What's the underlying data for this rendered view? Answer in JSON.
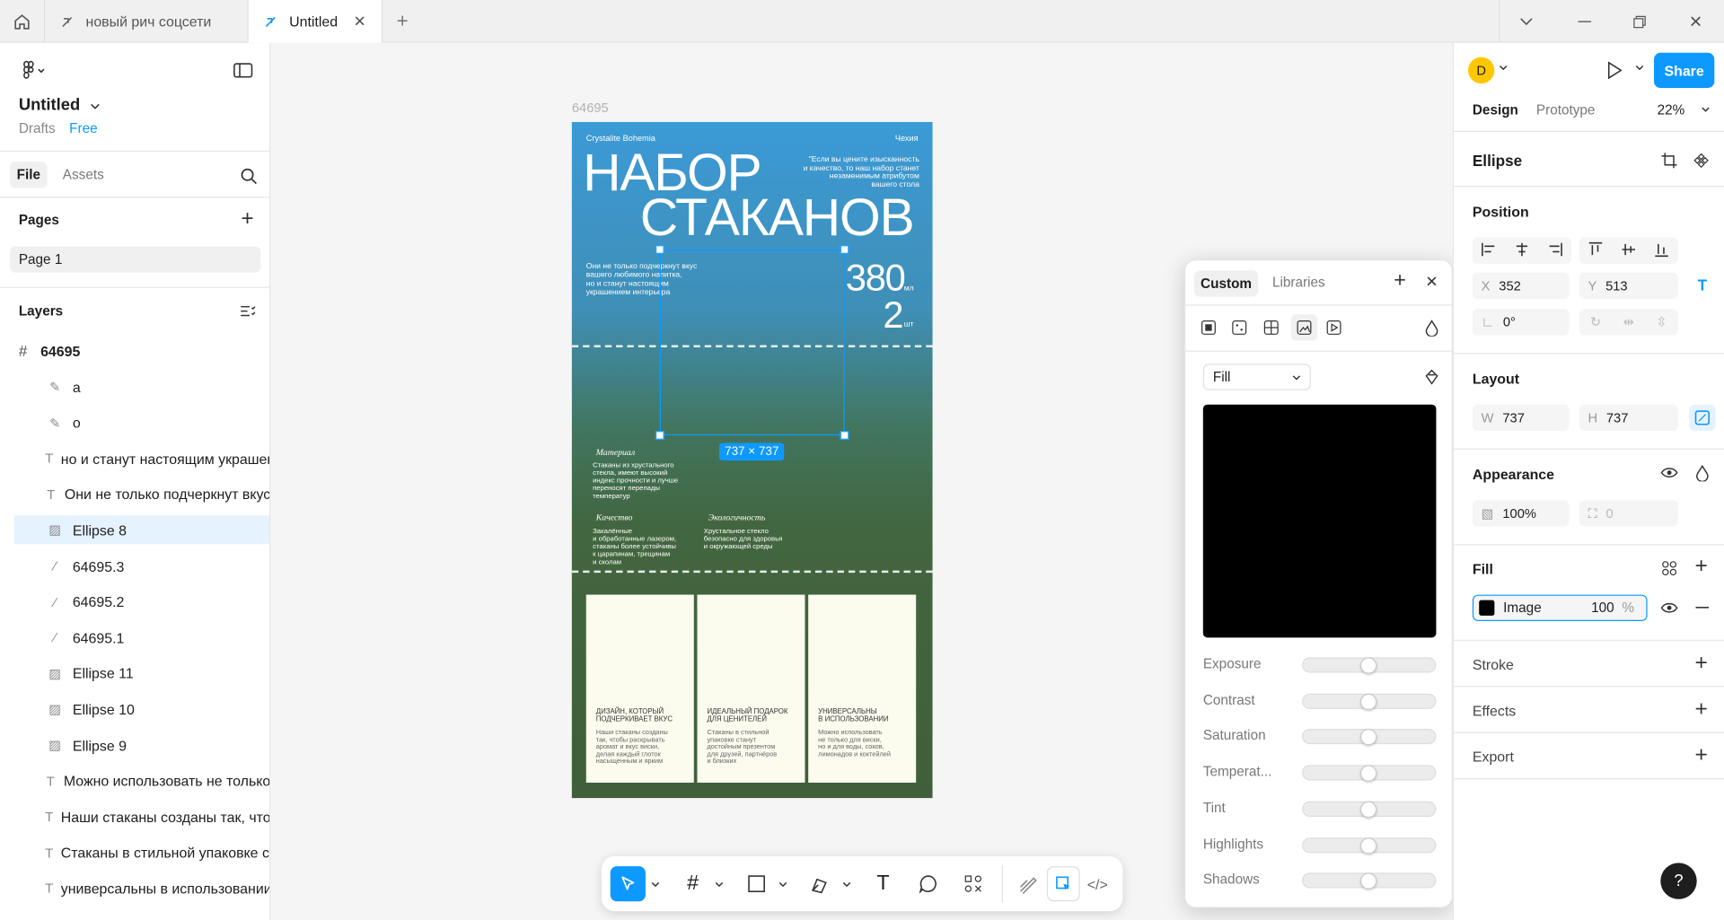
{
  "tabs": [
    {
      "label": "новый рич соцсети"
    },
    {
      "label": "Untitled"
    }
  ],
  "file": {
    "name": "Untitled",
    "drafts": "Drafts",
    "plan": "Free"
  },
  "left_tabs": {
    "file": "File",
    "assets": "Assets"
  },
  "pages": {
    "heading": "Pages",
    "items": [
      "Page 1"
    ]
  },
  "layers": {
    "heading": "Layers",
    "frame": "64695",
    "items": [
      {
        "icon": "pen-icon",
        "label": "a"
      },
      {
        "icon": "pen-icon",
        "label": "o"
      },
      {
        "icon": "text-icon",
        "label": "но и станут настоящим украшен"
      },
      {
        "icon": "text-icon",
        "label": "Они не только подчеркнут вкус"
      },
      {
        "icon": "image-icon",
        "label": "Ellipse 8",
        "selected": true
      },
      {
        "icon": "vector-icon",
        "label": "64695.3"
      },
      {
        "icon": "vector-icon",
        "label": "64695.2"
      },
      {
        "icon": "vector-icon",
        "label": "64695.1"
      },
      {
        "icon": "image-icon",
        "label": "Ellipse 11"
      },
      {
        "icon": "image-icon",
        "label": "Ellipse 10"
      },
      {
        "icon": "image-icon",
        "label": "Ellipse 9"
      },
      {
        "icon": "text-icon",
        "label": "Можно использовать не только"
      },
      {
        "icon": "text-icon",
        "label": "Наши стаканы созданы так, чтоб"
      },
      {
        "icon": "text-icon",
        "label": "Стаканы в стильной упаковке ст"
      },
      {
        "icon": "text-icon",
        "label": "универсальны в использовании"
      }
    ]
  },
  "canvas": {
    "frame_label": "64695",
    "selection_size": "737 × 737",
    "design": {
      "brand": "Crystalite Bohemia",
      "country": "Чехия",
      "title_line1": "НАБОР",
      "title_line2": "СТАКАНОВ",
      "quote": "\"Если вы цените изысканность\nи качество, то наш набор станет\nнезаменимым атрибутом\nвашего стола",
      "lead": "Они не только подчеркнут вкус\nвашего любимого напитка,\nно и станут настоящим\nукрашением интерьера",
      "volume": "380",
      "volume_unit": "мл",
      "count": "2",
      "count_unit": "шт",
      "f1_title": "Материал",
      "f1_text": "Стаканы из хрустального\nстекла, имеют высокий\nиндекс прочности и лучше\nпереносят перепады\nтемператур",
      "f2_title": "Качество",
      "f2_text": "Закалённые\nи обработанные лазером,\nстаканы более устойчивы\nк царапинам, трещинам\nи сколам",
      "f3_title": "Экологичность",
      "f3_text": "Хрустальное стекло\nбезопасно для здоровья\nи окружающей среды",
      "cards": [
        {
          "title": "ДИЗАЙН, КОТОРЫЙ\nПОДЧЕРКИВАЕТ ВКУС",
          "text": "Наши стаканы созданы\nтак, чтобы раскрывать\nаромат и вкус виски,\nделая каждый глоток\nнасыщенным и ярким"
        },
        {
          "title": "ИДЕАЛЬНЫЙ ПОДАРОК\nДЛЯ ЦЕНИТЕЛЕЙ",
          "text": "Стаканы в стильной\nупаковке станут\nдостойным презентом\nдля друзей, партнёров\nи близких"
        },
        {
          "title": "УНИВЕРСАЛЬНЫ\nВ ИСПОЛЬЗОВАНИИ",
          "text": "Можно использовать\nне только для виски,\nно и для воды, соков,\nлимонадов и коктейлей"
        }
      ]
    }
  },
  "fill_popup": {
    "tabs": [
      "Custom",
      "Libraries"
    ],
    "fill_mode": "Fill",
    "adjustments": [
      "Exposure",
      "Contrast",
      "Saturation",
      "Temperat...",
      "Tint",
      "Highlights",
      "Shadows"
    ],
    "adjustment_values": [
      0,
      0,
      0,
      0,
      0,
      0,
      0
    ]
  },
  "right": {
    "avatar": "D",
    "share": "Share",
    "tabs": {
      "design": "Design",
      "prototype": "Prototype"
    },
    "zoom": "22%",
    "selection_name": "Ellipse",
    "position": {
      "heading": "Position",
      "x_label": "X",
      "x": "352",
      "y_label": "Y",
      "y": "513",
      "rotation": "0°"
    },
    "layout": {
      "heading": "Layout",
      "w_label": "W",
      "w": "737",
      "h_label": "H",
      "h": "737"
    },
    "appearance": {
      "heading": "Appearance",
      "opacity": "100%",
      "radius": "0"
    },
    "fill": {
      "heading": "Fill",
      "type": "Image",
      "opacity": "100",
      "unit": "%"
    },
    "stroke": "Stroke",
    "effects": "Effects",
    "export": "Export",
    "help": "?"
  },
  "colors": {
    "accent": "#0d99ff",
    "selection_bg": "#e5f2ff",
    "avatar": "#ffc700"
  }
}
